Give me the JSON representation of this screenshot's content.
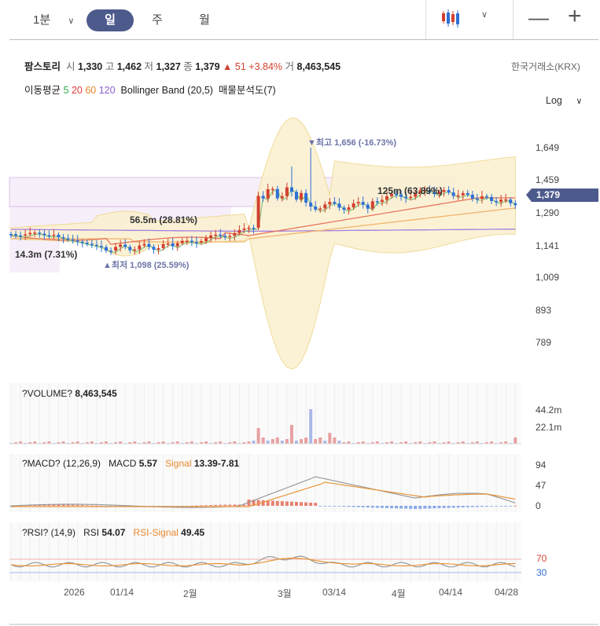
{
  "toolbar": {
    "interval": "1분",
    "tabs": [
      "일",
      "주",
      "월"
    ],
    "active_tab": "일",
    "chart_type_icon": "candlestick-icon",
    "zoom_out": "—",
    "zoom_in": "+"
  },
  "stock": {
    "name": "팜스토리",
    "open_label": "시",
    "open": "1,330",
    "high_label": "고",
    "high": "1,462",
    "low_label": "저",
    "low": "1,327",
    "close_label": "종",
    "close": "1,379",
    "change": "▲ 51",
    "change_pct": "+3.84%",
    "volume_label": "거",
    "volume": "8,463,545",
    "exchange": "한국거래소(KRX)"
  },
  "indicators": {
    "ma_label": "이동평균",
    "ma_periods": [
      "5",
      "20",
      "60",
      "120"
    ],
    "ma_colors": [
      "#2fae4f",
      "#e03c3c",
      "#e8882e",
      "#8a5cd0"
    ],
    "bollinger": "Bollinger Band (20,5)",
    "volume_profile": "매물분석도(7)"
  },
  "scale": {
    "mode": "Log"
  },
  "price_axis": [
    "1,649",
    "1,459",
    "1,290",
    "1,141",
    "1,009",
    "893",
    "789"
  ],
  "current_price": "1,379",
  "annotations": {
    "high": "▼최고 1,656 (-16.73%)",
    "low": "▲최저 1,098 (25.59%)",
    "profile1": "125m (63.89%)",
    "profile2": "56.5m (28.81%)",
    "profile3": "14.3m (7.31%)"
  },
  "volume_panel": {
    "title": "?VOLUME?",
    "value": "8,463,545",
    "ticks": [
      "44.2m",
      "22.1m"
    ]
  },
  "macd_panel": {
    "title": "?MACD? (12,26,9)",
    "macd_label": "MACD",
    "macd_value": "5.57",
    "signal_label": "Signal",
    "signal_value": "13.39-7.81",
    "ticks": [
      "94",
      "47",
      "0"
    ]
  },
  "rsi_panel": {
    "title": "?RSI? (14,9)",
    "rsi_label": "RSI",
    "rsi_value": "54.07",
    "signal_label": "RSI-Signal",
    "signal_value": "49.45",
    "ticks": [
      "70",
      "30"
    ]
  },
  "x_axis": [
    "2026",
    "01/14",
    "2월",
    "3월",
    "03/14",
    "4월",
    "04/14",
    "04/28"
  ],
  "colors": {
    "up": "#d2412f",
    "down": "#2f6fd6",
    "accent": "#4d5a8c",
    "band": "#f3dca0"
  }
}
